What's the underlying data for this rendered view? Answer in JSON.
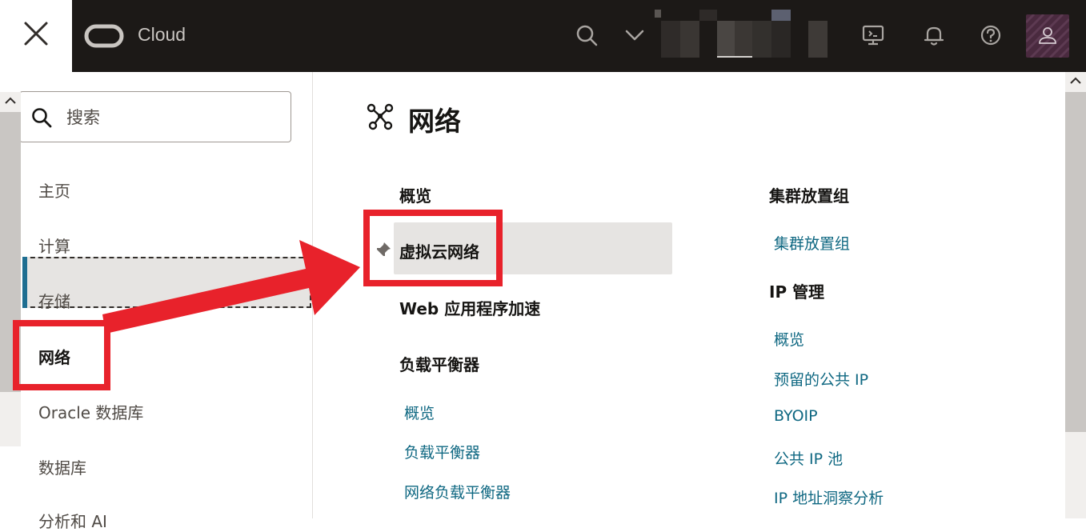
{
  "header": {
    "brand": "Cloud",
    "icons": [
      "close-icon",
      "oracle-logo",
      "search-icon",
      "chevron-down-icon",
      "cloud-shell-icon",
      "bell-icon",
      "help-icon",
      "avatar"
    ]
  },
  "search": {
    "placeholder": "搜索"
  },
  "sidebar": {
    "items": [
      {
        "label": "主页"
      },
      {
        "label": "计算"
      },
      {
        "label": "存储"
      },
      {
        "label": "网络",
        "selected": true
      },
      {
        "label": "Oracle 数据库"
      },
      {
        "label": "数据库"
      },
      {
        "label": "分析和 AI"
      }
    ]
  },
  "main": {
    "title": "网络",
    "left_column": {
      "overview": "概览",
      "vcn": "虚拟云网络",
      "web_accel": "Web 应用程序加速",
      "lb_heading": "负载平衡器",
      "lb_links": [
        "概览",
        "负载平衡器",
        "网络负载平衡器"
      ]
    },
    "right_column": {
      "cluster_heading": "集群放置组",
      "cluster_links": [
        "集群放置组"
      ],
      "ip_heading": "IP 管理",
      "ip_links": [
        "概览",
        "预留的公共 IP",
        "BYOIP",
        "公共 IP 池",
        "IP 地址洞察分析"
      ]
    }
  },
  "colors": {
    "topbar": "#1c1917",
    "link": "#0f6882",
    "selection_accent": "#1e6e91",
    "annotation": "#e8222b"
  }
}
